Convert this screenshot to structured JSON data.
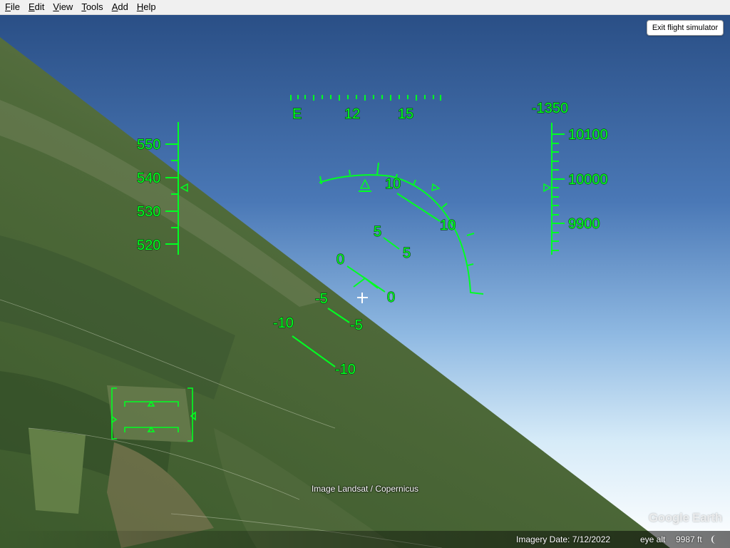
{
  "menu": {
    "file": {
      "u": "F",
      "rest": "ile"
    },
    "edit": {
      "u": "E",
      "rest": "dit"
    },
    "view": {
      "u": "V",
      "rest": "iew"
    },
    "tools": {
      "u": "T",
      "rest": "ools"
    },
    "add": {
      "u": "A",
      "rest": "dd"
    },
    "help": {
      "u": "H",
      "rest": "elp"
    }
  },
  "exit_button": "Exit flight simulator",
  "hud": {
    "color": "#00ff22",
    "heading_labels": [
      "E",
      "12",
      "15"
    ],
    "vertical_speed": "-1350",
    "speed_labels": [
      "550",
      "540",
      "530",
      "520"
    ],
    "altitude_labels": [
      "10100",
      "10000",
      "9900"
    ],
    "bank_label": "10",
    "pitch_ladder": [
      {
        "left": "10",
        "right": "10"
      },
      {
        "left": "5",
        "right": "5"
      },
      {
        "left": "0",
        "right": "0"
      },
      {
        "left": "-5",
        "right": "-5"
      },
      {
        "left": "-10",
        "right": "-10"
      }
    ]
  },
  "attribution": "Image Landsat / Copernicus",
  "logo": "Google Earth",
  "status": {
    "imagery_date": "Imagery Date: 7/12/2022",
    "eye_alt": "eye alt",
    "eye_alt_value": "9987 ft"
  }
}
